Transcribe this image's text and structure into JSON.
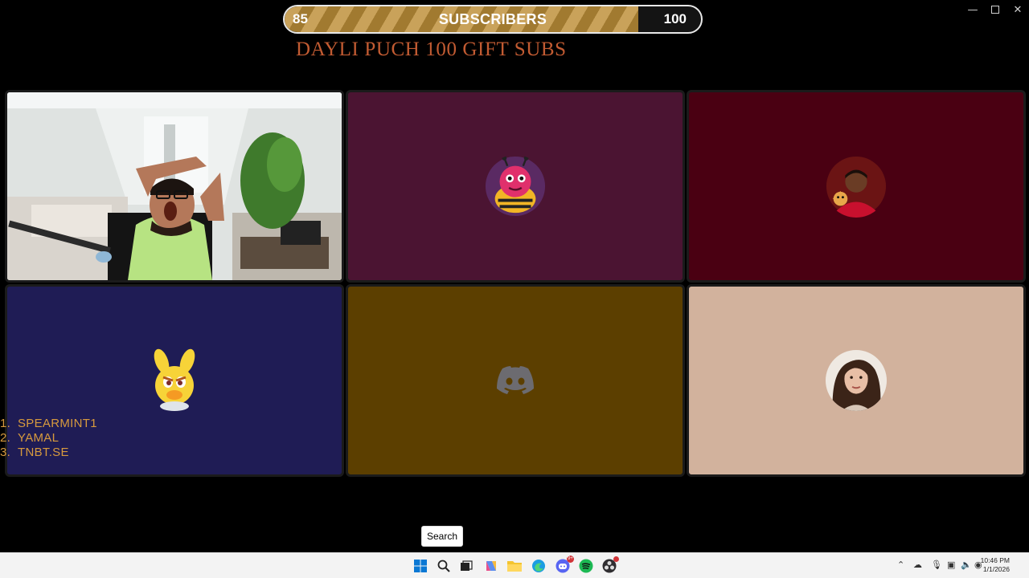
{
  "window": {
    "controls": [
      "minimize",
      "maximize",
      "close"
    ]
  },
  "goal": {
    "current": "85",
    "label": "SUBSCRIBERS",
    "target": "100",
    "progress_fraction": 0.85,
    "fill_color": "#a17a30",
    "stripe_color": "#c9a25a"
  },
  "headline": "DAYLI  PUCH 100 GIFT SUBS",
  "tiles": [
    {
      "name": "webcam-feed",
      "background": "#cfd6d2"
    },
    {
      "name": "participant-2",
      "avatar_icon": "cartoon-bee-avatar",
      "background": "#4b1432"
    },
    {
      "name": "participant-3",
      "avatar_icon": "football-player-avatar",
      "background": "#4a0012"
    },
    {
      "name": "participant-4",
      "avatar_icon": "yellow-bunny-avatar",
      "background": "#1f1c55"
    },
    {
      "name": "participant-5",
      "avatar_icon": "discord-logo",
      "background": "#5c3f00"
    },
    {
      "name": "participant-6",
      "avatar_icon": "woman-photo-avatar",
      "background": "#d2b29d"
    }
  ],
  "leaderboard": [
    {
      "rank": "1.",
      "name": "SPEARMINT1"
    },
    {
      "rank": "2.",
      "name": "YAMAL"
    },
    {
      "rank": "3.",
      "name": "TNBT.SE"
    }
  ],
  "tooltip": "Search",
  "taskbar": {
    "icons": [
      "windows-start-icon",
      "search-icon",
      "task-view-icon",
      "copilot-icon",
      "file-explorer-icon",
      "edge-icon",
      "discord-icon",
      "spotify-icon",
      "obs-icon"
    ],
    "discord_badge": "9+",
    "tray_icons": [
      "chevron-up-icon",
      "onedrive-icon",
      "microphone-icon",
      "display-icon",
      "volume-icon",
      "network-icon"
    ],
    "time": "10:46 PM",
    "date": "1/1/2026"
  }
}
